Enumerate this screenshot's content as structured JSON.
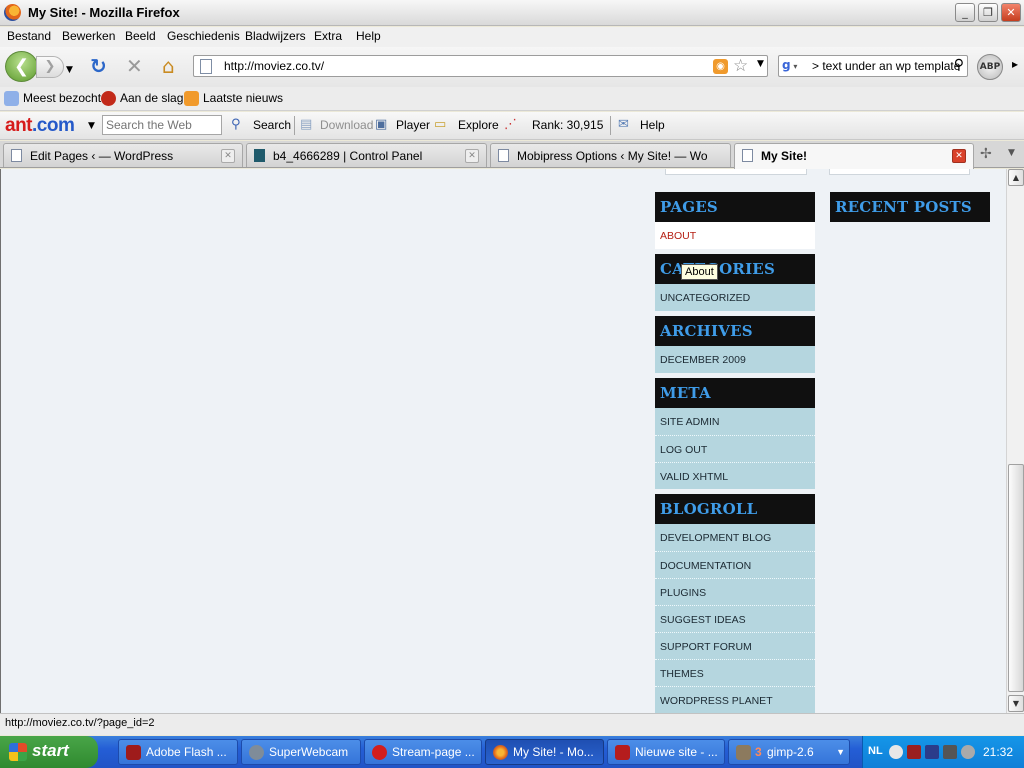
{
  "window": {
    "title": "My Site! - Mozilla Firefox"
  },
  "menu": [
    "Bestand",
    "Bewerken",
    "Beeld",
    "Geschiedenis",
    "Bladwijzers",
    "Extra",
    "Help"
  ],
  "nav": {
    "url": "http://moviez.co.tv/",
    "search_value": "> text under an wp template",
    "abp_label": "ABP"
  },
  "bookmarks": [
    "Meest bezocht",
    "Aan de slag",
    "Laatste nieuws"
  ],
  "antbar": {
    "logo_ant": "ant",
    "logo_com": ".com",
    "search_placeholder": "Search the Web",
    "search_label": "Search",
    "download_label": "Download",
    "player_label": "Player",
    "explore_label": "Explore",
    "rank_label": "Rank: 30,915",
    "help_label": "Help"
  },
  "tabs": [
    {
      "label": "Edit Pages ‹ — WordPress"
    },
    {
      "label": "b4_4666289 | Control Panel"
    },
    {
      "label": "Mobipress Options ‹ My Site! — Word..."
    },
    {
      "label": "My Site!"
    }
  ],
  "sidebar": {
    "pages": {
      "title": "PAGES",
      "items": [
        "ABOUT"
      ]
    },
    "categories": {
      "title": "CATEGORIES",
      "items": [
        "UNCATEGORIZED"
      ]
    },
    "archives": {
      "title": "ARCHIVES",
      "items": [
        "DECEMBER 2009"
      ]
    },
    "meta": {
      "title": "META",
      "items": [
        "SITE ADMIN",
        "LOG OUT",
        "VALID XHTML"
      ]
    },
    "blogroll": {
      "title": "BLOGROLL",
      "items": [
        "DEVELOPMENT BLOG",
        "DOCUMENTATION",
        "PLUGINS",
        "SUGGEST IDEAS",
        "SUPPORT FORUM",
        "THEMES",
        "WORDPRESS PLANET"
      ]
    },
    "recent": {
      "title": "RECENT POSTS"
    }
  },
  "tooltip": "About",
  "status": "http://moviez.co.tv/?page_id=2",
  "taskbar": {
    "start": "start",
    "tasks": [
      "Adobe Flash ...",
      "SuperWebcam",
      "Stream-page ...",
      "My Site! - Mo...",
      "Nieuwe site - ...",
      "gimp-2.6"
    ],
    "gimp_count": "3",
    "lang": "NL",
    "clock": "21:32"
  },
  "colors": {
    "widget_header_bg": "#101010",
    "widget_title": "#3f9ce8",
    "widget_item_bg": "#b5d6df",
    "link_red": "#b52014"
  }
}
